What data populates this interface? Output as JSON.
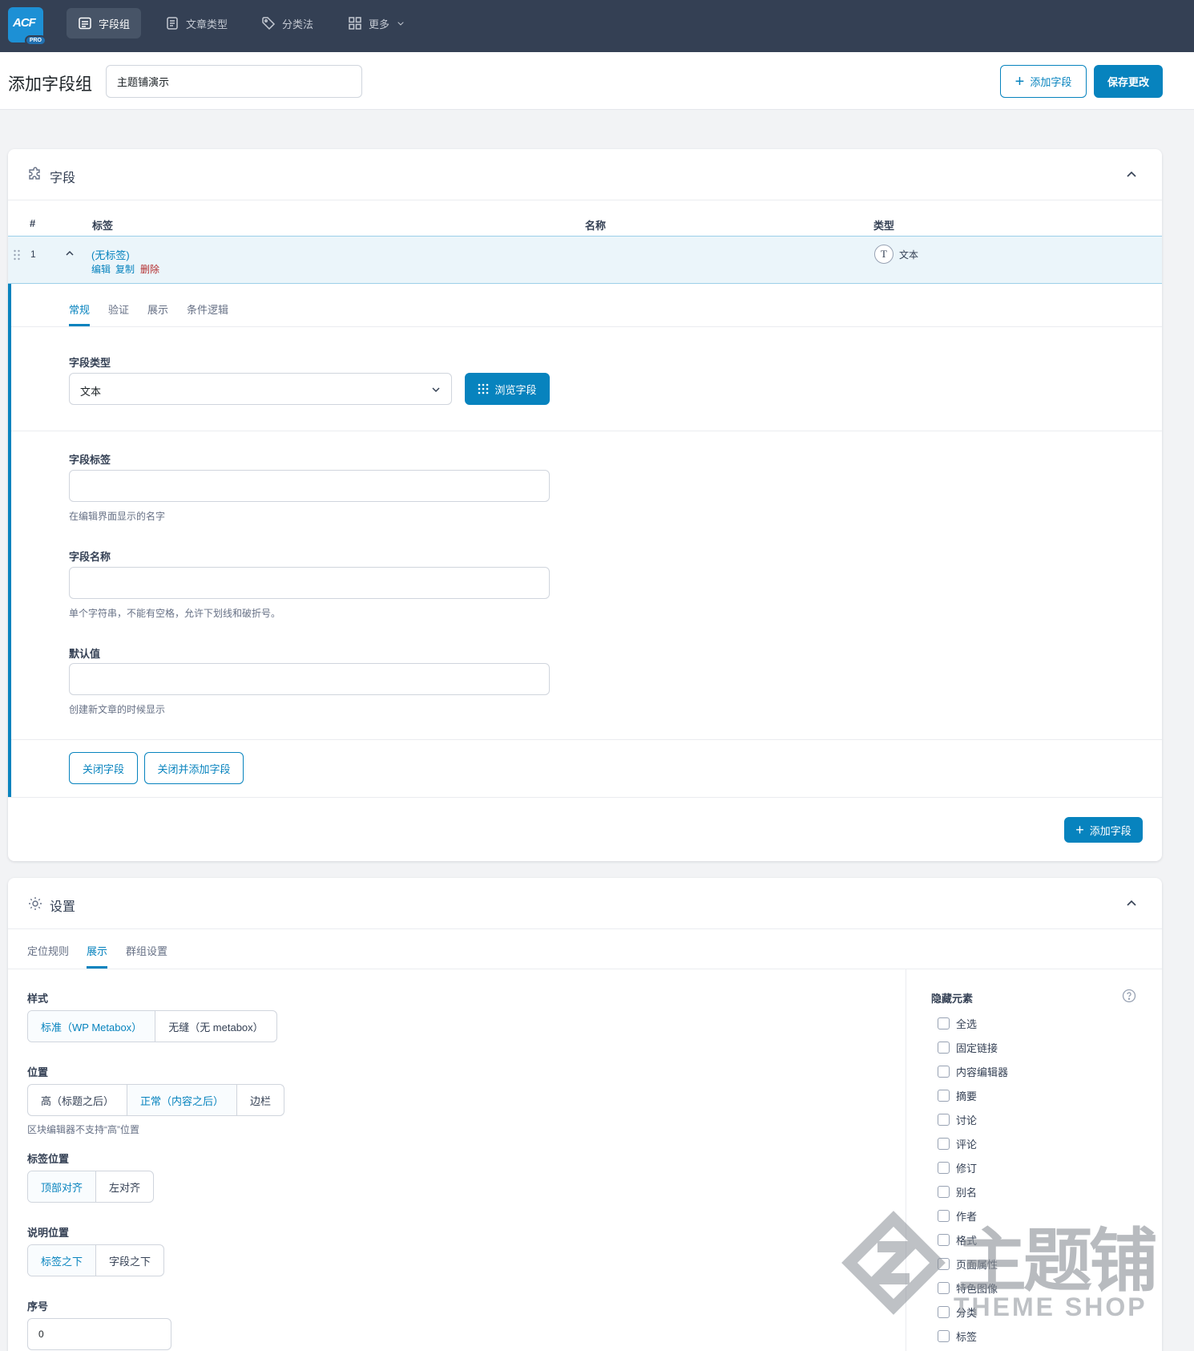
{
  "app": {
    "logo_text": "ACF",
    "logo_badge": "PRO"
  },
  "nav": {
    "items": [
      {
        "label": "字段组",
        "icon": "list-icon",
        "active": true
      },
      {
        "label": "文章类型",
        "icon": "document-icon",
        "active": false
      },
      {
        "label": "分类法",
        "icon": "tag-icon",
        "active": false
      },
      {
        "label": "更多",
        "icon": "grid-icon",
        "active": false
      }
    ]
  },
  "header": {
    "title": "添加字段组",
    "group_title_value": "主题铺演示",
    "add_field_label": "添加字段",
    "save_label": "保存更改"
  },
  "fields_panel": {
    "title": "字段",
    "columns": {
      "order": "#",
      "label": "标签",
      "name": "名称",
      "type": "类型"
    },
    "row": {
      "order": "1",
      "label": "(无标签)",
      "actions": [
        "编辑",
        "复制",
        "删除"
      ],
      "type_icon": "T",
      "type": "文本"
    },
    "tabs": [
      "常规",
      "验证",
      "展示",
      "条件逻辑"
    ],
    "field_type_label": "字段类型",
    "field_type_value": "文本",
    "browse_label": "浏览字段",
    "field_label_label": "字段标签",
    "field_label_hint": "在编辑界面显示的名字",
    "field_name_label": "字段名称",
    "field_name_hint": "单个字符串，不能有空格，允许下划线和破折号。",
    "default_label": "默认值",
    "default_hint": "创建新文章的时候显示",
    "close_label": "关闭字段",
    "close_add_label": "关闭并添加字段",
    "add_field_label": "添加字段"
  },
  "settings_panel": {
    "title": "设置",
    "tabs": [
      "定位规则",
      "展示",
      "群组设置"
    ],
    "style_label": "样式",
    "style_options": [
      "标准（WP Metabox）",
      "无缝（无 metabox）"
    ],
    "position_label": "位置",
    "position_options": [
      "高（标题之后）",
      "正常（内容之后）",
      "边栏"
    ],
    "position_hint": "区块编辑器不支持“高”位置",
    "label_position_label": "标签位置",
    "label_position_options": [
      "顶部对齐",
      "左对齐"
    ],
    "instruction_label": "说明位置",
    "instruction_options": [
      "标签之下",
      "字段之下"
    ],
    "order_label": "序号",
    "order_value": "0",
    "hide_label": "隐藏元素",
    "hide_items": [
      "全选",
      "固定链接",
      "内容编辑器",
      "摘要",
      "讨论",
      "评论",
      "修订",
      "别名",
      "作者",
      "格式",
      "页面属性",
      "特色图像",
      "分类",
      "标签"
    ]
  },
  "watermark": {
    "cn": "主题铺",
    "en": "THEME SHOP"
  },
  "colors": {
    "accent": "#0783be",
    "topbar": "#344054",
    "row_highlight": "#ebf5fa"
  }
}
